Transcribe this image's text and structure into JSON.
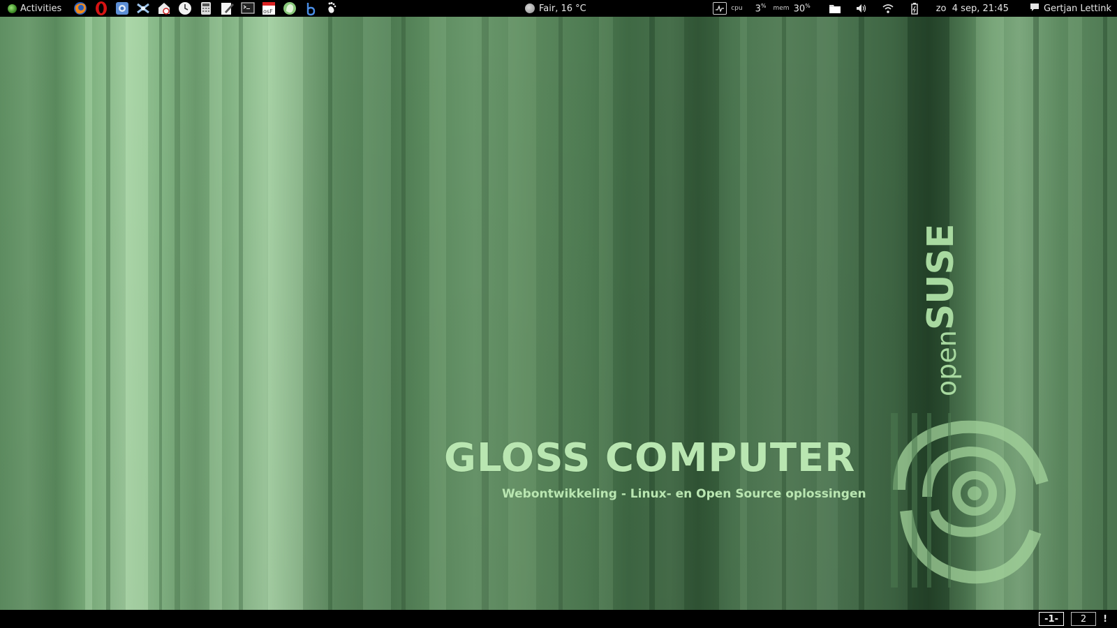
{
  "top_panel": {
    "activities_label": "Activities",
    "launchers": [
      {
        "name": "firefox-icon"
      },
      {
        "name": "opera-icon"
      },
      {
        "name": "chromium-icon"
      },
      {
        "name": "network-tool-icon"
      },
      {
        "name": "mail-client-icon"
      },
      {
        "name": "clock-app-icon"
      },
      {
        "name": "calculator-icon"
      },
      {
        "name": "text-editor-icon"
      },
      {
        "name": "terminal-icon"
      },
      {
        "name": "screenshot-tool-icon"
      },
      {
        "name": "evernote-icon"
      },
      {
        "name": "bluefish-icon"
      },
      {
        "name": "gnome-foot-icon"
      }
    ],
    "weather": "Fair, 16 °C",
    "cpu_label": "cpu",
    "cpu_value": "3",
    "cpu_unit": "%",
    "mem_label": "mem",
    "mem_value": "30",
    "mem_unit": "%",
    "clock": "zo  4 sep, 21:45",
    "user_name": "Gertjan Lettink"
  },
  "desktop": {
    "title": "GLOSS COMPUTER",
    "subtitle": "Webontwikkeling - Linux- en Open Source oplossingen",
    "brand_open": "open",
    "brand_suse": "SUSE"
  },
  "bottom_panel": {
    "workspaces": [
      "-1-",
      "2"
    ],
    "active_workspace_index": 0,
    "message_indicator": "!"
  },
  "colors": {
    "panel_bg": "#000000",
    "wallpaper_accent": "#b9e6b1",
    "panel_text": "#e6e6e6"
  }
}
